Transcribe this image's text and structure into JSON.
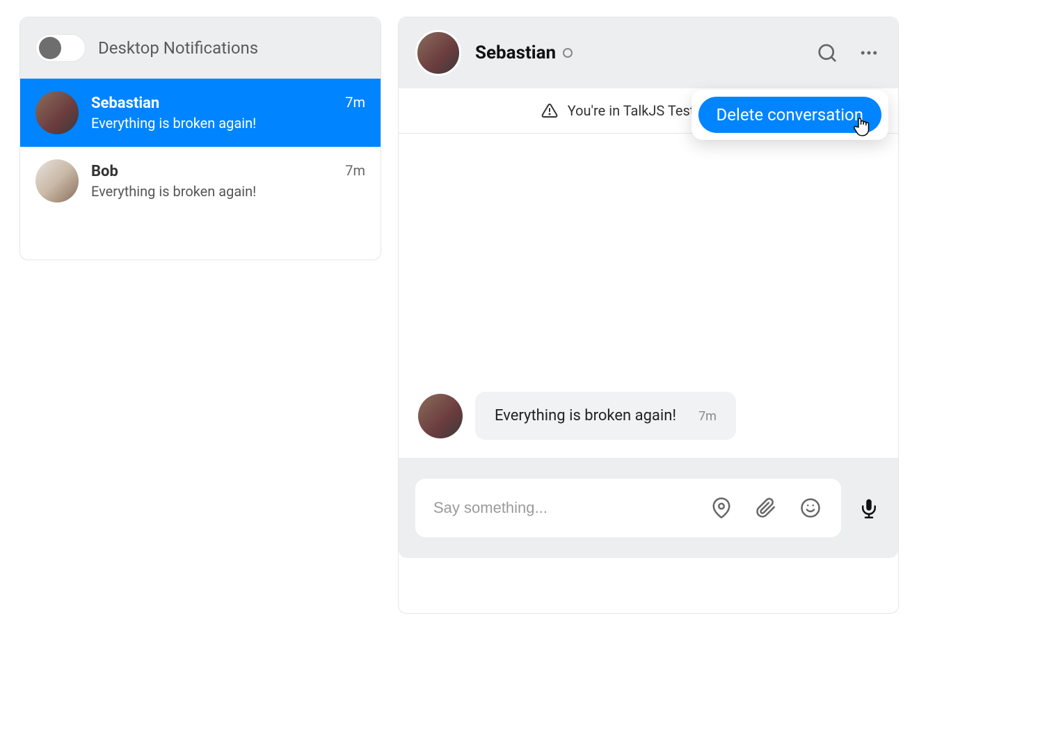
{
  "sidebar": {
    "notifications_toggle_label": "Desktop Notifications",
    "items": [
      {
        "name": "Sebastian",
        "preview": "Everything is broken again!",
        "time": "7m",
        "selected": true
      },
      {
        "name": "Bob",
        "preview": "Everything is broken again!",
        "time": "7m",
        "selected": false
      }
    ]
  },
  "chat": {
    "header": {
      "title": "Sebastian"
    },
    "banner": {
      "text": "You're in TalkJS Test Mode. To"
    },
    "popmenu": {
      "delete_label": "Delete conversation"
    },
    "messages": [
      {
        "text": "Everything is broken again!",
        "time": "7m"
      }
    ],
    "input": {
      "placeholder": "Say something..."
    }
  },
  "colors": {
    "accent": "#0084ff",
    "header_bg": "#eceef0",
    "bubble_bg": "#f1f2f4"
  }
}
